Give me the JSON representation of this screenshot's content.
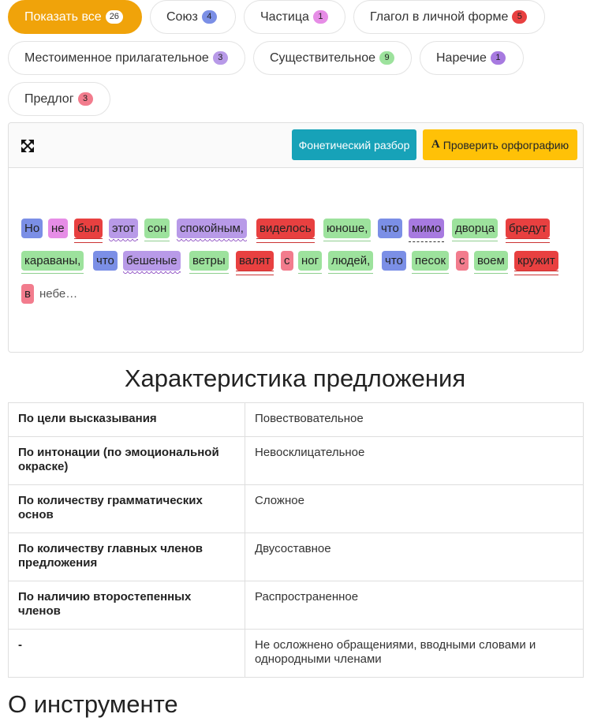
{
  "filters": [
    {
      "label": "Показать все",
      "count": "26",
      "badge_color": "#ffffff",
      "active": true
    },
    {
      "label": "Союз",
      "count": "4",
      "badge_color": "#7b8fe6"
    },
    {
      "label": "Частица",
      "count": "1",
      "badge_color": "#e68de6"
    },
    {
      "label": "Глагол в личной форме",
      "count": "5",
      "badge_color": "#e84040"
    },
    {
      "label": "Местоименное прилагательное",
      "count": "3",
      "badge_color": "#b89ae8"
    },
    {
      "label": "Существительное",
      "count": "9",
      "badge_color": "#9de29d"
    },
    {
      "label": "Наречие",
      "count": "1",
      "badge_color": "#a77ae0"
    },
    {
      "label": "Предлог",
      "count": "3",
      "badge_color": "#f27c8d"
    }
  ],
  "toolbar": {
    "expand_icon": "expand-arrows-icon",
    "phonetic_label": "Фонетический разбор",
    "spell_icon": "A",
    "spell_label": "Проверить орфографию"
  },
  "words": [
    {
      "text": "Но",
      "pos": "union"
    },
    {
      "text": "не",
      "pos": "part"
    },
    {
      "text": "был",
      "pos": "verb",
      "underline": "double"
    },
    {
      "text": "этот",
      "pos": "pron",
      "underline": "wavy"
    },
    {
      "text": "сон",
      "pos": "noun",
      "underline": "green"
    },
    {
      "text": "спокойным,",
      "pos": "pron",
      "underline": "wavy"
    },
    {
      "text": "виделось",
      "pos": "verb",
      "underline": "double"
    },
    {
      "text": "юноше,",
      "pos": "noun",
      "underline": "green"
    },
    {
      "text": "что",
      "pos": "union"
    },
    {
      "text": "мимо",
      "pos": "adv",
      "underline": "dashdot"
    },
    {
      "text": "дворца",
      "pos": "noun",
      "underline": "green"
    },
    {
      "text": "бредут",
      "pos": "verb",
      "underline": "double"
    },
    {
      "text": "караваны,",
      "pos": "noun",
      "underline": "green"
    },
    {
      "text": "что",
      "pos": "union"
    },
    {
      "text": "бешеные",
      "pos": "pron",
      "underline": "wavy"
    },
    {
      "text": "ветры",
      "pos": "noun",
      "underline": "green"
    },
    {
      "text": "валят",
      "pos": "verb",
      "underline": "double"
    },
    {
      "text": "с",
      "pos": "prep"
    },
    {
      "text": "ног",
      "pos": "noun",
      "underline": "green"
    },
    {
      "text": "людей,",
      "pos": "noun",
      "underline": "green"
    },
    {
      "text": "что",
      "pos": "union"
    },
    {
      "text": "песок",
      "pos": "noun",
      "underline": "green"
    },
    {
      "text": "с",
      "pos": "prep"
    },
    {
      "text": "воем",
      "pos": "noun",
      "underline": "green"
    },
    {
      "text": "кружит",
      "pos": "verb",
      "underline": "double"
    },
    {
      "text": "в",
      "pos": "prep"
    },
    {
      "text": "небе…",
      "pos": "plain"
    }
  ],
  "section_title": "Характеристика предложения",
  "table": [
    {
      "key": "По цели высказывания",
      "value": "Повествовательное"
    },
    {
      "key": "По интонации (по эмоциональной окраске)",
      "value": "Невосклицательное"
    },
    {
      "key": "По количеству грамматических основ",
      "value": "Сложное"
    },
    {
      "key": "По количеству главных членов предложения",
      "value": "Двусоставное"
    },
    {
      "key": "По наличию второстепенных членов",
      "value": "Распространенное"
    },
    {
      "key": "-",
      "value": "Не осложнено обращениями, вводными словами и однородными членами"
    }
  ],
  "about_title": "О инструменте"
}
